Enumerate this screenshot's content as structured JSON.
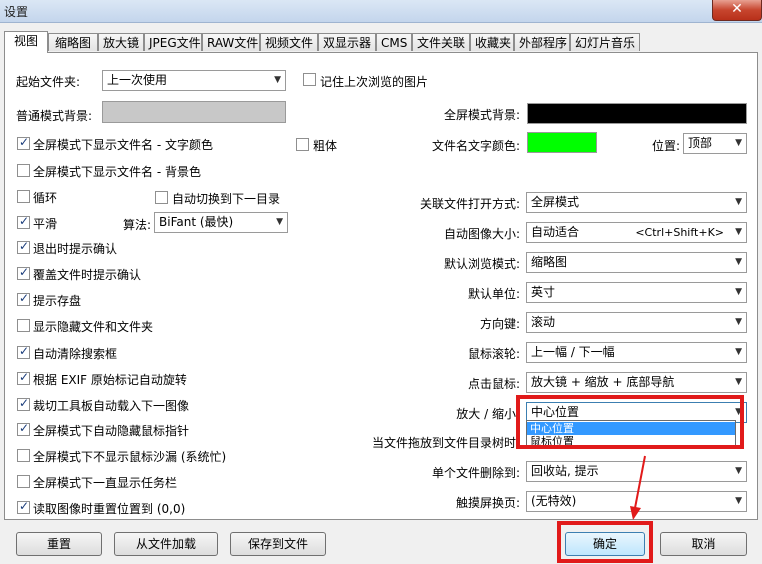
{
  "window": {
    "title": "设置",
    "close_label": "✕"
  },
  "tabs": [
    "视图",
    "缩略图",
    "放大镜",
    "JPEG文件",
    "RAW文件",
    "视频文件",
    "双显示器",
    "CMS",
    "文件关联",
    "收藏夹",
    "外部程序",
    "幻灯片音乐"
  ],
  "left": {
    "start_folder_label": "起始文件夹:",
    "start_folder_value": "上一次使用",
    "remember_last_label": "记住上次浏览的图片",
    "normal_bg_label": "普通模式背景:",
    "options": [
      {
        "label": "全屏模式下显示文件名 - 文字颜色",
        "checked": true
      },
      {
        "label": "全屏模式下显示文件名 - 背景色",
        "checked": false
      },
      {
        "label": "循环",
        "checked": false
      },
      {
        "label": "平滑",
        "checked": true
      },
      {
        "label": "退出时提示确认",
        "checked": true
      },
      {
        "label": "覆盖文件时提示确认",
        "checked": true
      },
      {
        "label": "提示存盘",
        "checked": true
      },
      {
        "label": "显示隐藏文件和文件夹",
        "checked": false
      },
      {
        "label": "自动清除搜索框",
        "checked": true
      },
      {
        "label": "根据 EXIF 原始标记自动旋转",
        "checked": true
      },
      {
        "label": "裁切工具板自动载入下一图像",
        "checked": true
      },
      {
        "label": "全屏模式下自动隐藏鼠标指针",
        "checked": true
      },
      {
        "label": "全屏模式下不显示鼠标沙漏 (系统忙)",
        "checked": false
      },
      {
        "label": "全屏模式下一直显示任务栏",
        "checked": false
      },
      {
        "label": "读取图像时重置位置到 (0,0)",
        "checked": true
      }
    ],
    "bold_label": "粗体",
    "auto_next_folder_label": "自动切换到下一目录",
    "algorithm_label": "算法:",
    "algorithm_value": "BiFant (最快)"
  },
  "right": {
    "fullscreen_bg_label": "全屏模式背景:",
    "filename_color_label": "文件名文字颜色:",
    "position_label": "位置:",
    "position_value": "顶部",
    "colors": {
      "fullscreen_bg": "#000000",
      "filename_text": "#00ff00",
      "normal_bg": "#c8c8c8"
    },
    "rows": [
      {
        "label": "关联文件打开方式:",
        "value": "全屏模式"
      },
      {
        "label": "自动图像大小:",
        "value": "自动适合",
        "shortcut": "<Ctrl+Shift+K>"
      },
      {
        "label": "默认浏览模式:",
        "value": "缩略图"
      },
      {
        "label": "默认单位:",
        "value": "英寸"
      },
      {
        "label": "方向键:",
        "value": "滚动"
      },
      {
        "label": "鼠标滚轮:",
        "value": "上一幅 / 下一幅"
      },
      {
        "label": "点击鼠标:",
        "value": "放大镜 + 缩放 + 底部导航"
      },
      {
        "label": "放大 / 缩小:",
        "value": "中心位置"
      },
      {
        "label": "当文件拖放到文件目录树时:",
        "value": ""
      },
      {
        "label": "单个文件删除到:",
        "value": "回收站, 提示"
      },
      {
        "label": "触摸屏换页:",
        "value": "(无特效)"
      }
    ],
    "dropdown_options": [
      "中心位置",
      "鼠标位置"
    ]
  },
  "buttons": {
    "reset": "重置",
    "load": "从文件加载",
    "save": "保存到文件",
    "ok": "确定",
    "cancel": "取消"
  }
}
